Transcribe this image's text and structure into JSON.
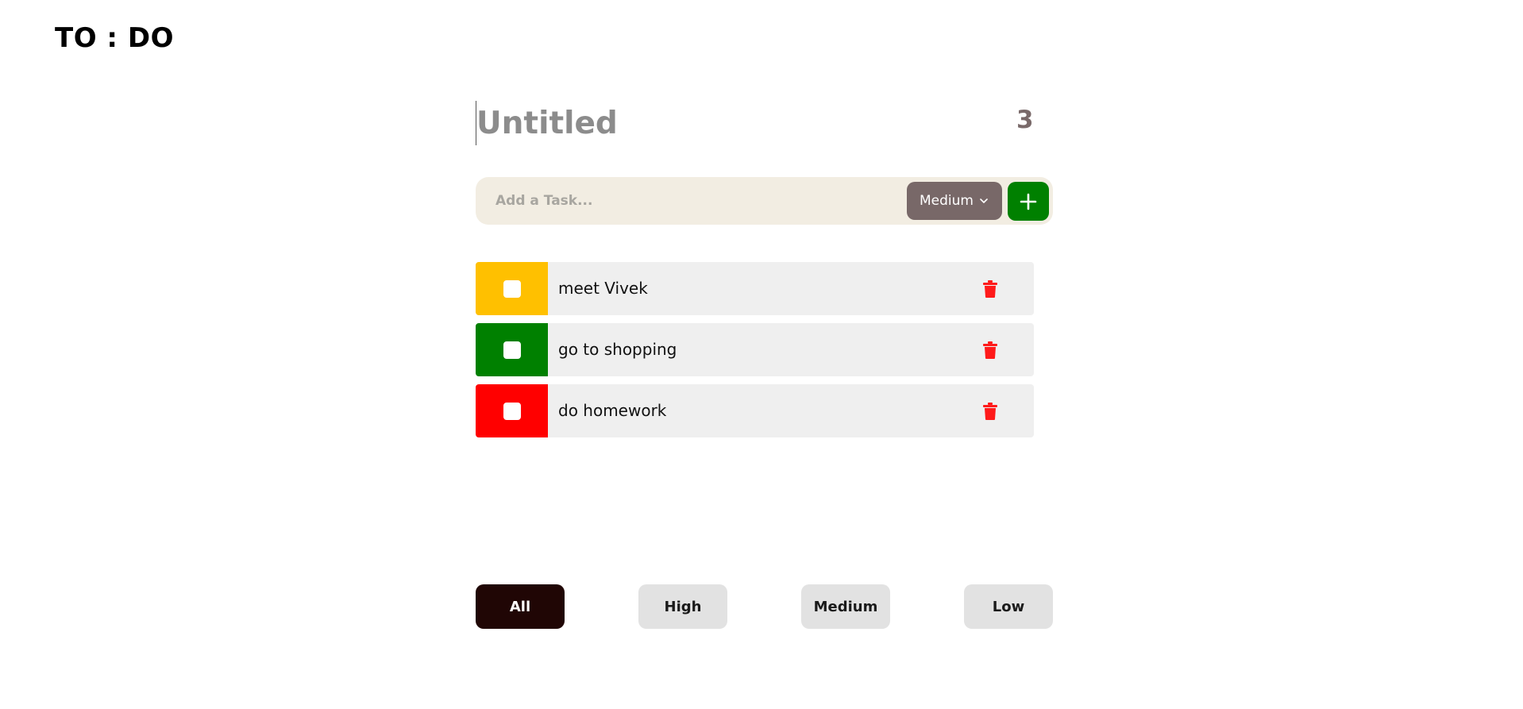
{
  "app": {
    "logo": "TO : DO"
  },
  "list": {
    "title_placeholder": "Untitled",
    "task_count": "3"
  },
  "add_task": {
    "placeholder": "Add a Task...",
    "priority_selected": "Medium",
    "add_icon": "plus-icon"
  },
  "colors": {
    "high": "#ff0000",
    "medium": "#ffc000",
    "low": "#008000",
    "delete": "#ff1a1a",
    "active_filter": "#200605"
  },
  "tasks": [
    {
      "text": "meet Vivek",
      "priority": "medium"
    },
    {
      "text": "go to shopping",
      "priority": "low"
    },
    {
      "text": "do homework",
      "priority": "high"
    }
  ],
  "filters": [
    {
      "label": "All",
      "active": true
    },
    {
      "label": "High",
      "active": false
    },
    {
      "label": "Medium",
      "active": false
    },
    {
      "label": "Low",
      "active": false
    }
  ]
}
